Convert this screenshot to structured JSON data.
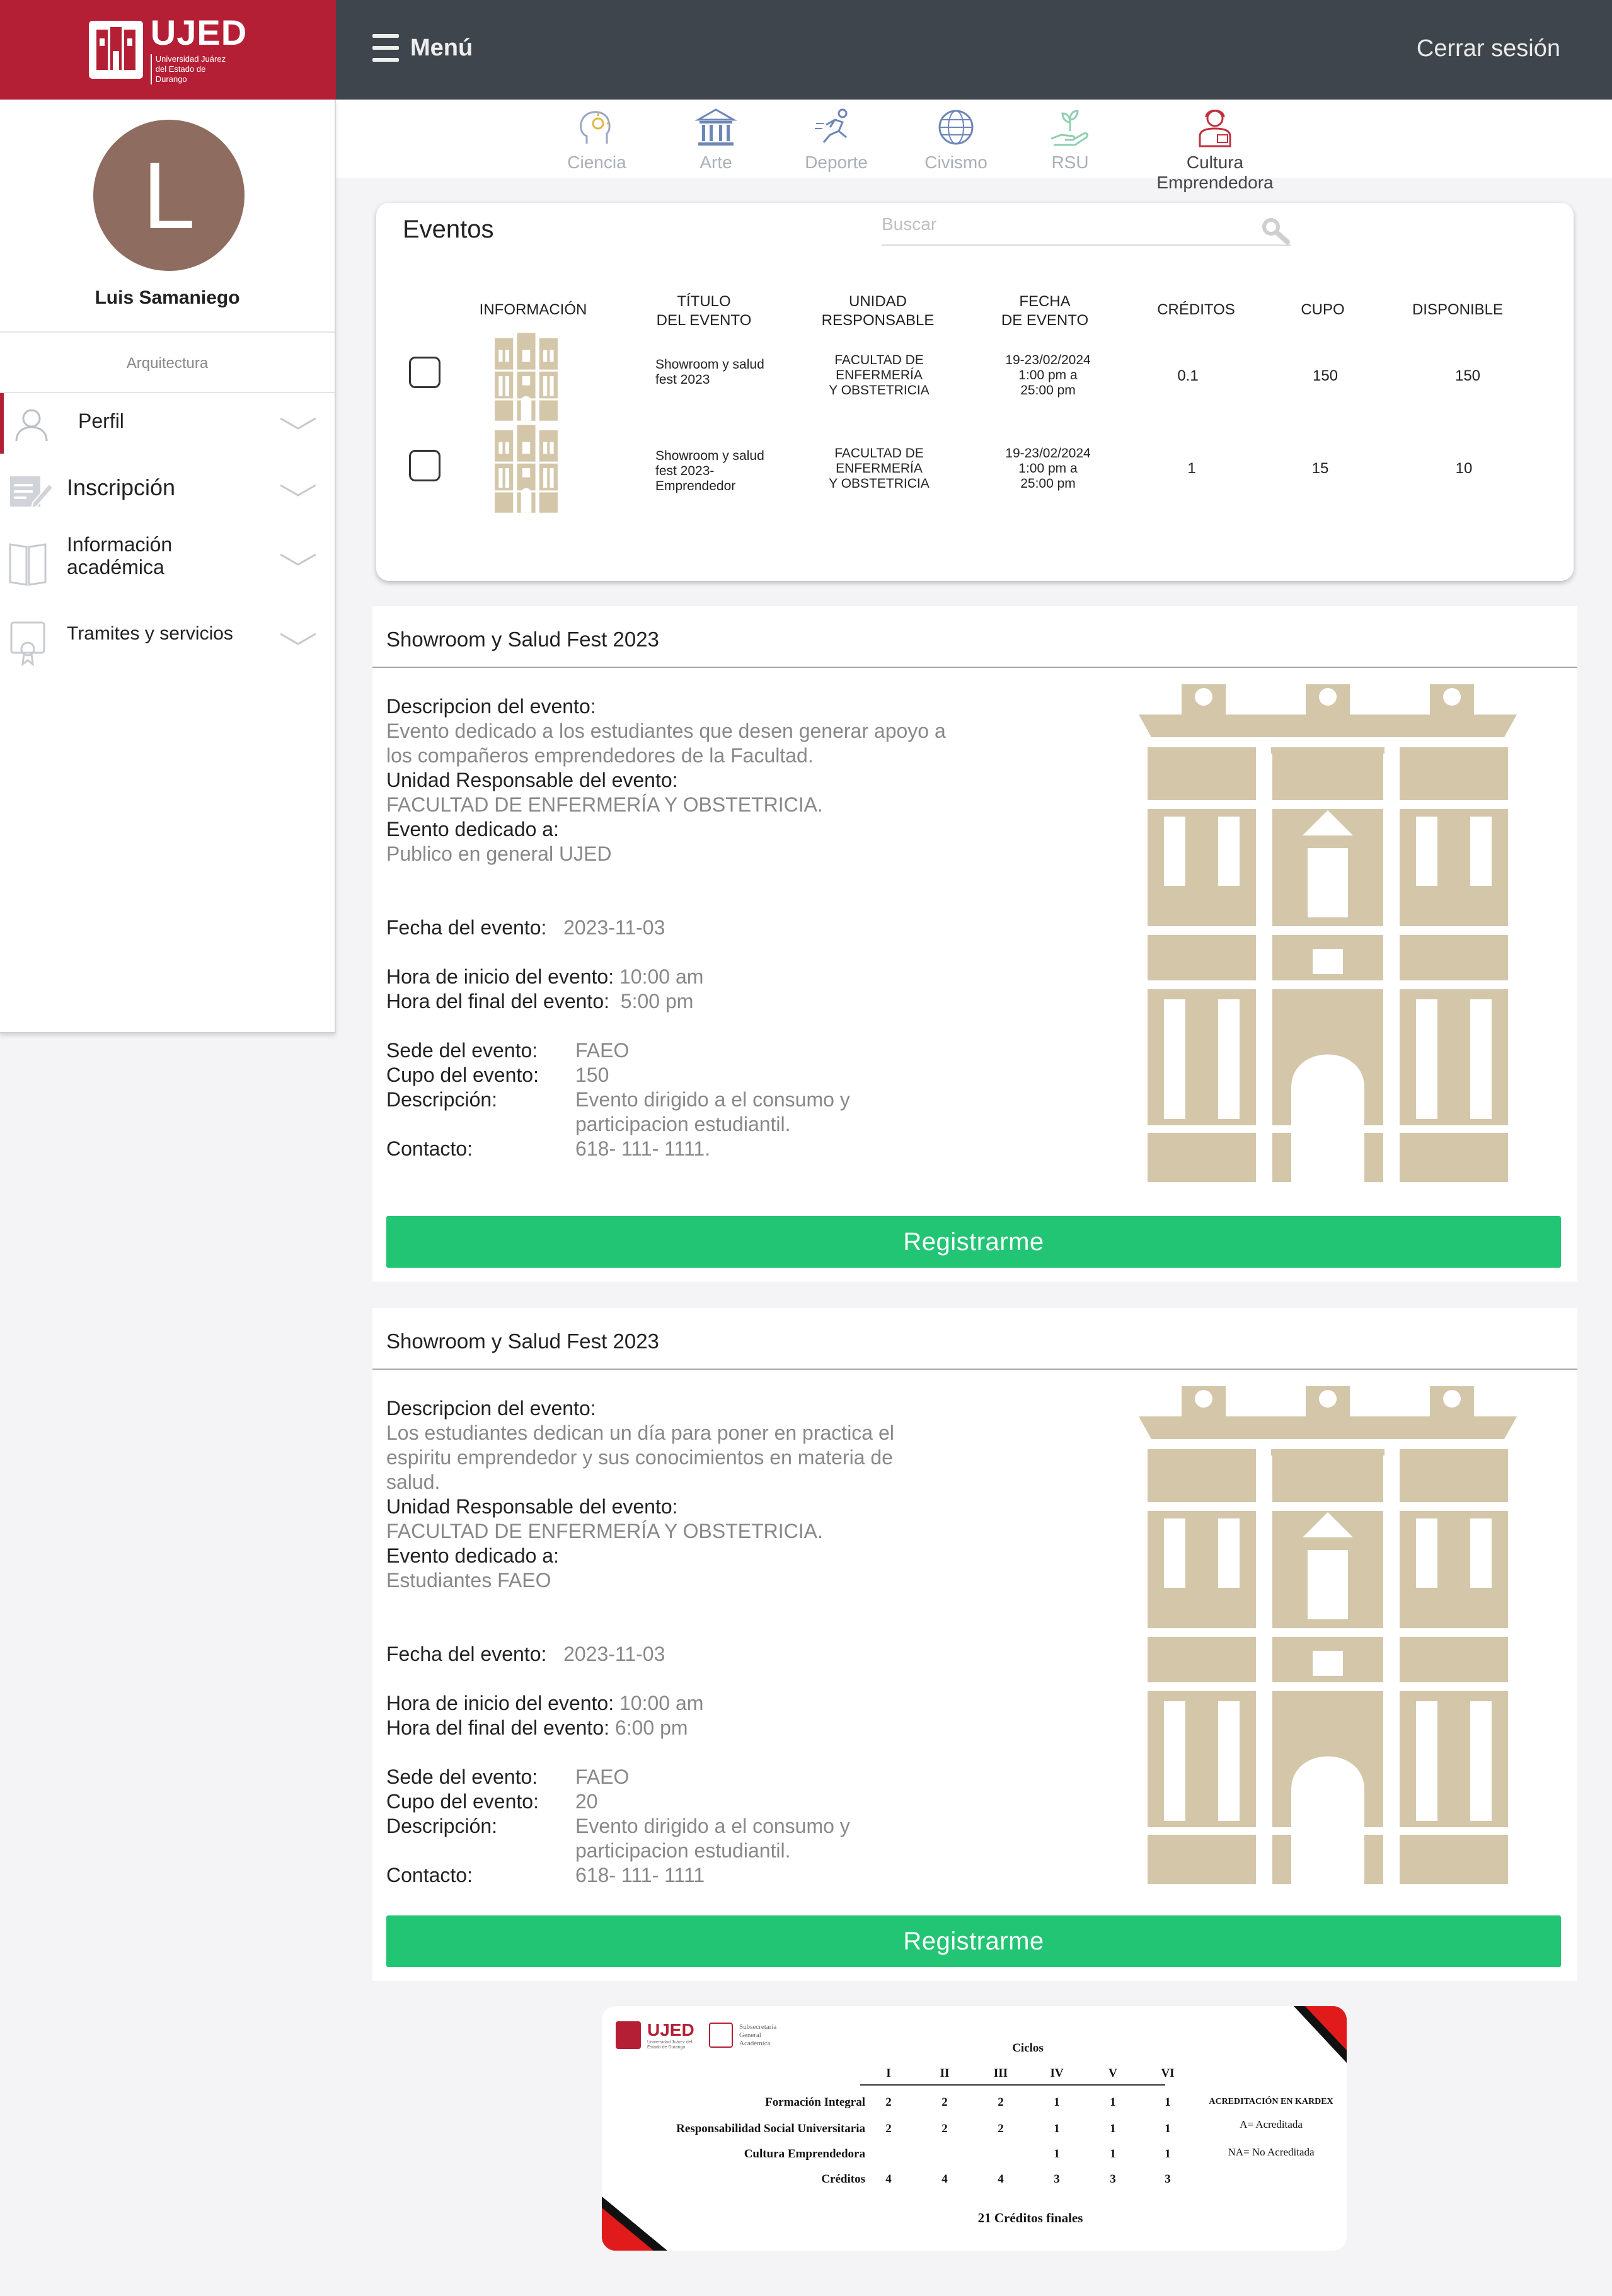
{
  "brand": {
    "name": "UJED",
    "subtitle": "Universidad Juárez del Estado de Durango",
    "color": "#b51f35"
  },
  "topbar": {
    "menu_label": "Menú",
    "logout_label": "Cerrar sesión",
    "bg": "#3f454c"
  },
  "categories": [
    {
      "label": "Ciencia",
      "icon": "science-head-icon",
      "active": false
    },
    {
      "label": "Arte",
      "icon": "museum-icon",
      "active": false
    },
    {
      "label": "Deporte",
      "icon": "runner-icon",
      "active": false
    },
    {
      "label": "Civismo",
      "icon": "globe-icon",
      "active": false
    },
    {
      "label": "RSU",
      "icon": "hand-plant-icon",
      "active": false
    },
    {
      "label": "Cultura Emprendedora",
      "icon": "entrepreneur-icon",
      "active": true
    }
  ],
  "sidebar": {
    "avatar_letter": "L",
    "user_name": "Luis Samaniego",
    "career": "Arquitectura",
    "items": [
      {
        "label": "Perfil",
        "icon": "user-icon"
      },
      {
        "label": "Inscripción",
        "icon": "form-icon"
      },
      {
        "label": "Información académica",
        "icon": "book-icon"
      },
      {
        "label": "Tramites y servicios",
        "icon": "certificate-icon"
      }
    ]
  },
  "events": {
    "title": "Eventos",
    "search_placeholder": "Buscar",
    "columns": {
      "info": "INFORMACIÓN",
      "title": [
        "TÍTULO",
        "DEL EVENTO"
      ],
      "unit": [
        "UNIDAD",
        "RESPONSABLE"
      ],
      "date": [
        "FECHA",
        "DE EVENTO"
      ],
      "credits": "CRÉDITOS",
      "capacity": "CUPO",
      "available": "DISPONIBLE"
    },
    "rows": [
      {
        "title": [
          "Showroom y salud",
          "fest 2023"
        ],
        "unit": [
          "FACULTAD DE",
          "ENFERMERÍA",
          "Y OBSTETRICIA"
        ],
        "date": [
          "19-23/02/2024",
          "1:00 pm a",
          "25:00 pm"
        ],
        "credits": "0.1",
        "capacity": "150",
        "available": "150"
      },
      {
        "title": [
          "Showroom y salud",
          "fest 2023-",
          "Emprendedor"
        ],
        "unit": [
          "FACULTAD DE",
          "ENFERMERÍA",
          "Y OBSTETRICIA"
        ],
        "date": [
          "19-23/02/2024",
          "1:00 pm a",
          "25:00 pm"
        ],
        "credits": "1",
        "capacity": "15",
        "available": "10"
      }
    ]
  },
  "details": [
    {
      "heading": "Showroom y Salud Fest 2023",
      "desc_label": "Descripcion del evento:",
      "desc": [
        "Evento dedicado a los estudiantes que desen generar apoyo a",
        "los compañeros emprendedores de la Facultad."
      ],
      "unit_label": "Unidad Responsable del evento:",
      "unit": "FACULTAD DE ENFERMERÍA Y OBSTETRICIA.",
      "dedicated_label": "Evento dedicado a:",
      "dedicated": "Publico en general UJED",
      "date_label": "Fecha del evento:",
      "date": "2023-11-03",
      "start_label": "Hora de inicio del evento:",
      "start": "10:00 am",
      "end_label": "Hora del final del evento:",
      "end": "5:00 pm",
      "venue_label": "Sede del evento:",
      "venue": "FAEO",
      "capacity_label": "Cupo del evento:",
      "capacity": "150",
      "description_label": "Descripción:",
      "description": [
        "Evento dirigido a el consumo y",
        "participacion estudiantil."
      ],
      "contact_label": "Contacto:",
      "contact": "618- 111- 1111.",
      "button": "Registrarme"
    },
    {
      "heading": "Showroom y Salud Fest 2023",
      "desc_label": "Descripcion del evento:",
      "desc": [
        "Los estudiantes dedican un día para poner en practica el",
        "espiritu emprendedor y sus conocimientos en materia de",
        "salud."
      ],
      "unit_label": "Unidad Responsable del evento:",
      "unit": "FACULTAD DE ENFERMERÍA Y OBSTETRICIA.",
      "dedicated_label": "Evento dedicado a:",
      "dedicated": "Estudiantes FAEO",
      "date_label": "Fecha del evento:",
      "date": "2023-11-03",
      "start_label": "Hora de inicio del evento:",
      "start": "10:00 am",
      "end_label": "Hora del final del evento:",
      "end": "6:00 pm",
      "venue_label": "Sede del evento:",
      "venue": "FAEO",
      "capacity_label": "Cupo del evento:",
      "capacity": "20",
      "description_label": "Descripción:",
      "description": [
        "Evento dirigido a el consumo y",
        "participacion estudiantil."
      ],
      "contact_label": "Contacto:",
      "contact": "618- 111- 1111",
      "button": "Registrarme"
    }
  ],
  "credits_table": {
    "logo_text": "UJED",
    "logo_sub": "Universidad Juárez del Estado de Durango",
    "dept": [
      "Subsecretaría",
      "General",
      "Académica"
    ],
    "header": "Ciclos",
    "cycles": [
      "I",
      "II",
      "III",
      "IV",
      "V",
      "VI"
    ],
    "rows": [
      {
        "label": "Formación Integral",
        "values": [
          "2",
          "2",
          "2",
          "1",
          "1",
          "1"
        ]
      },
      {
        "label": "Responsabilidad Social Universitaria",
        "values": [
          "2",
          "2",
          "2",
          "1",
          "1",
          "1"
        ]
      },
      {
        "label": "Cultura Emprendedora",
        "values": [
          "",
          "",
          "",
          "1",
          "1",
          "1"
        ]
      },
      {
        "label": "Créditos",
        "values": [
          "4",
          "4",
          "4",
          "3",
          "3",
          "3"
        ]
      }
    ],
    "legend_title": "ACREDITACIÓN EN KARDEX",
    "legend": [
      "A= Acreditada",
      "NA= No Acreditada"
    ],
    "total": "21 Créditos finales"
  },
  "colors": {
    "accent": "#b51f35",
    "register": "#22c573",
    "emblem": "#d3c6a9"
  }
}
